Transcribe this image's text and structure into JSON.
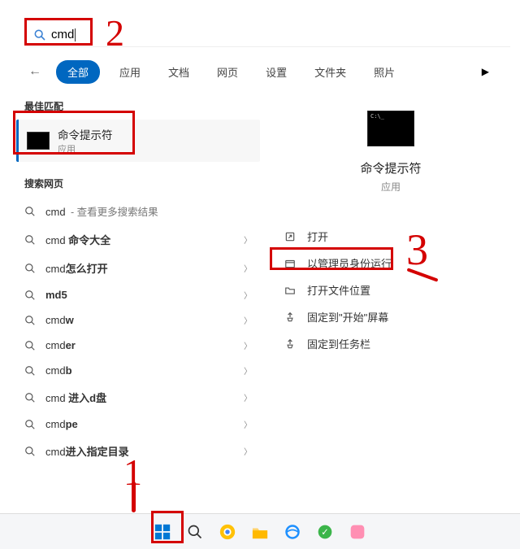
{
  "search": {
    "value": "cmd"
  },
  "tabs": {
    "items": [
      "全部",
      "应用",
      "文档",
      "网页",
      "设置",
      "文件夹",
      "照片"
    ],
    "active_index": 0
  },
  "sections": {
    "best_match_header": "最佳匹配",
    "web_search_header": "搜索网页"
  },
  "best_match": {
    "title": "命令提示符",
    "subtitle": "应用"
  },
  "web_results": [
    {
      "prefix": "cmd",
      "bold": "",
      "suffix": " - 查看更多搜索结果",
      "chev": false
    },
    {
      "prefix": "cmd ",
      "bold": "命令大全",
      "suffix": "",
      "chev": true
    },
    {
      "prefix": "cmd",
      "bold": "怎么打开",
      "suffix": "",
      "chev": true
    },
    {
      "prefix": "",
      "bold": "md5",
      "suffix": "",
      "chev": true
    },
    {
      "prefix": "cmd",
      "bold": "w",
      "suffix": "",
      "chev": true
    },
    {
      "prefix": "cmd",
      "bold": "er",
      "suffix": "",
      "chev": true
    },
    {
      "prefix": "cmd",
      "bold": "b",
      "suffix": "",
      "chev": true
    },
    {
      "prefix": "cmd ",
      "bold": "进入d盘",
      "suffix": "",
      "chev": true
    },
    {
      "prefix": "cmd",
      "bold": "pe",
      "suffix": "",
      "chev": true
    },
    {
      "prefix": "cmd",
      "bold": "进入指定目录",
      "suffix": "",
      "chev": true
    }
  ],
  "details": {
    "title": "命令提示符",
    "subtitle": "应用",
    "actions": [
      {
        "icon": "open",
        "label": "打开"
      },
      {
        "icon": "admin",
        "label": "以管理员身份运行"
      },
      {
        "icon": "folder",
        "label": "打开文件位置"
      },
      {
        "icon": "pin",
        "label": "固定到\"开始\"屏幕"
      },
      {
        "icon": "pin",
        "label": "固定到任务栏"
      }
    ]
  },
  "annotations": {
    "label1": "1",
    "label2": "2",
    "label3": "3"
  }
}
